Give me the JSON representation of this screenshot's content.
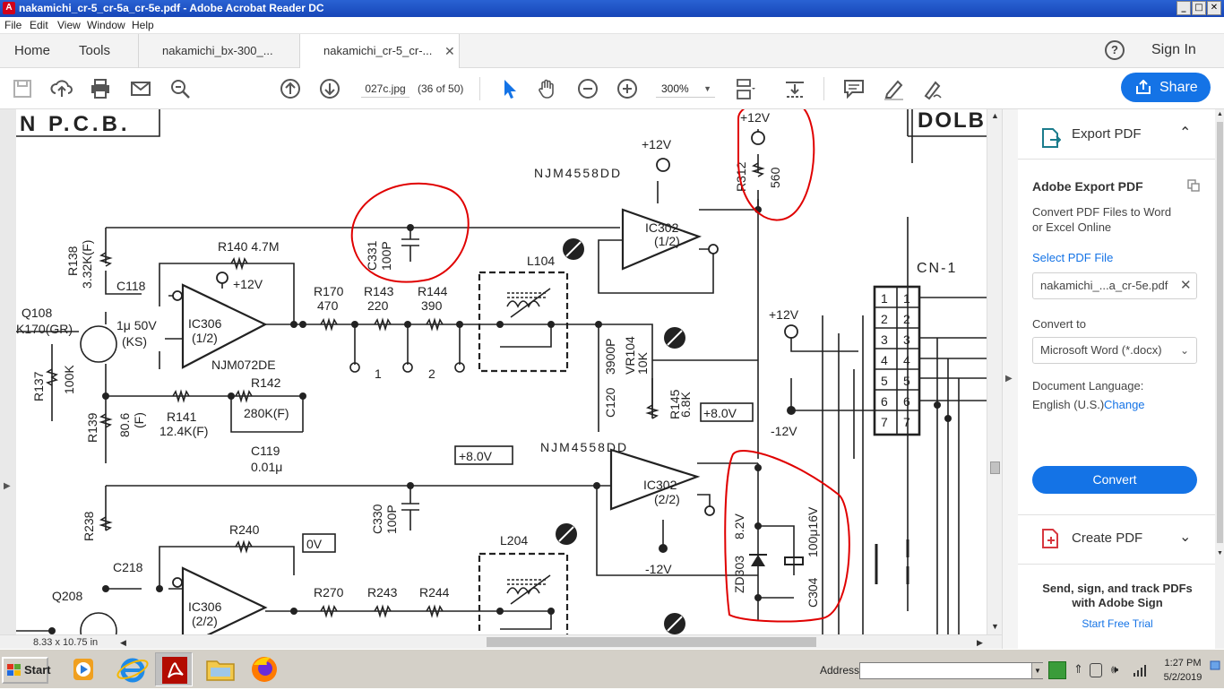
{
  "window": {
    "title": "nakamichi_cr-5_cr-5a_cr-5e.pdf - Adobe Acrobat Reader DC",
    "controls": [
      "_",
      "□",
      "✕"
    ]
  },
  "menu": [
    "File",
    "Edit",
    "View",
    "Window",
    "Help"
  ],
  "tabs": {
    "home": "Home",
    "tools": "Tools",
    "doc1": "nakamichi_bx-300_...",
    "doc2": "nakamichi_cr-5_cr-...",
    "close": "✕",
    "help": "?",
    "signin": "Sign In"
  },
  "toolbar": {
    "page_field": "027c.jpg",
    "page_count": "(36 of 50)",
    "zoom": "300%",
    "share": "Share"
  },
  "document": {
    "page_size": "8.33 x 10.75 in",
    "schematic_labels": {
      "title": "N P.C.B.",
      "dolby": "DOLB",
      "njm_top": "NJM4558DD",
      "njm_bottom": "NJM4558DD",
      "njm072": "NJM072DE",
      "ic302a": "IC302",
      "ic302a_sub": "(1/2)",
      "ic302b": "IC302",
      "ic302b_sub": "(2/2)",
      "ic306a": "IC306",
      "ic306a_sub": "(1/2)",
      "ic306b": "IC306",
      "ic306b_sub": "(2/2)",
      "plus12_a": "+12V",
      "plus12_b": "+12V",
      "plus12_c": "+12V",
      "plus12_d": "+12V",
      "minus12_a": "-12V",
      "minus12_b": "-12V",
      "plus8_a": "+8.0V",
      "plus8_b": "+8.0V",
      "zero_v": "0V",
      "r312": "R312",
      "r312v": "560",
      "c331": "C331",
      "c331v": "100P",
      "c330": "C330",
      "c330v": "100P",
      "l104": "L104",
      "l204": "L204",
      "cn1": "CN-1",
      "r138": "R138",
      "r138v": "3.32K(F)",
      "r140": "R140 4.7M",
      "c118": "C118",
      "c118v": "1μ 50V",
      "c118ks": "(KS)",
      "q108": "Q108",
      "q108v": "K170(GR)",
      "r137": "R137",
      "r137v": "100K",
      "r139": "R139",
      "r139v": "80.6",
      "r139f": "(F)",
      "r141": "R141",
      "r141v": "12.4K(F)",
      "r142": "R142",
      "r142v": "280K(F)",
      "c119": "C119",
      "c119v": "0.01μ",
      "r170": "R170",
      "r170v": "470",
      "r143": "R143",
      "r143v": "220",
      "r144": "R144",
      "r144v": "390",
      "c120": "C120",
      "c120v": "3900P",
      "vr104": "VR104",
      "vr104v": "10K",
      "r145": "R145",
      "r145v": "6.8K",
      "zd303": "ZD303",
      "zd303v": "8.2V",
      "c304": "C304",
      "c304v": "100μ16V",
      "r238": "R238",
      "c218": "C218",
      "q208": "Q208",
      "r240": "R240",
      "r270": "R270",
      "r243": "R243",
      "r244": "R244",
      "circ1": "1",
      "circ2": "2",
      "pins": [
        "1",
        "2",
        "3",
        "4",
        "5",
        "6",
        "7"
      ]
    }
  },
  "right_pane": {
    "export_title": "Export PDF",
    "adobe_export": "Adobe Export PDF",
    "description": "Convert PDF Files to Word or Excel Online",
    "select_file_label": "Select PDF File",
    "file_name": "nakamichi_...a_cr-5e.pdf",
    "convert_to_label": "Convert to",
    "convert_to_value": "Microsoft Word (*.docx)",
    "language_label": "Document Language:",
    "language_value": "English (U.S.)",
    "change_link": "Change",
    "convert_button": "Convert",
    "create_title": "Create PDF",
    "promo": "Send, sign, and track PDFs with Adobe Sign",
    "trial_link": "Start Free Trial"
  },
  "taskbar": {
    "start": "Start",
    "address_label": "Address",
    "time": "1:27 PM",
    "date": "5/2/2019"
  },
  "colors": {
    "accent": "#1473e6",
    "annotation": "#e00000",
    "titlebar": "#1d4fc0"
  }
}
